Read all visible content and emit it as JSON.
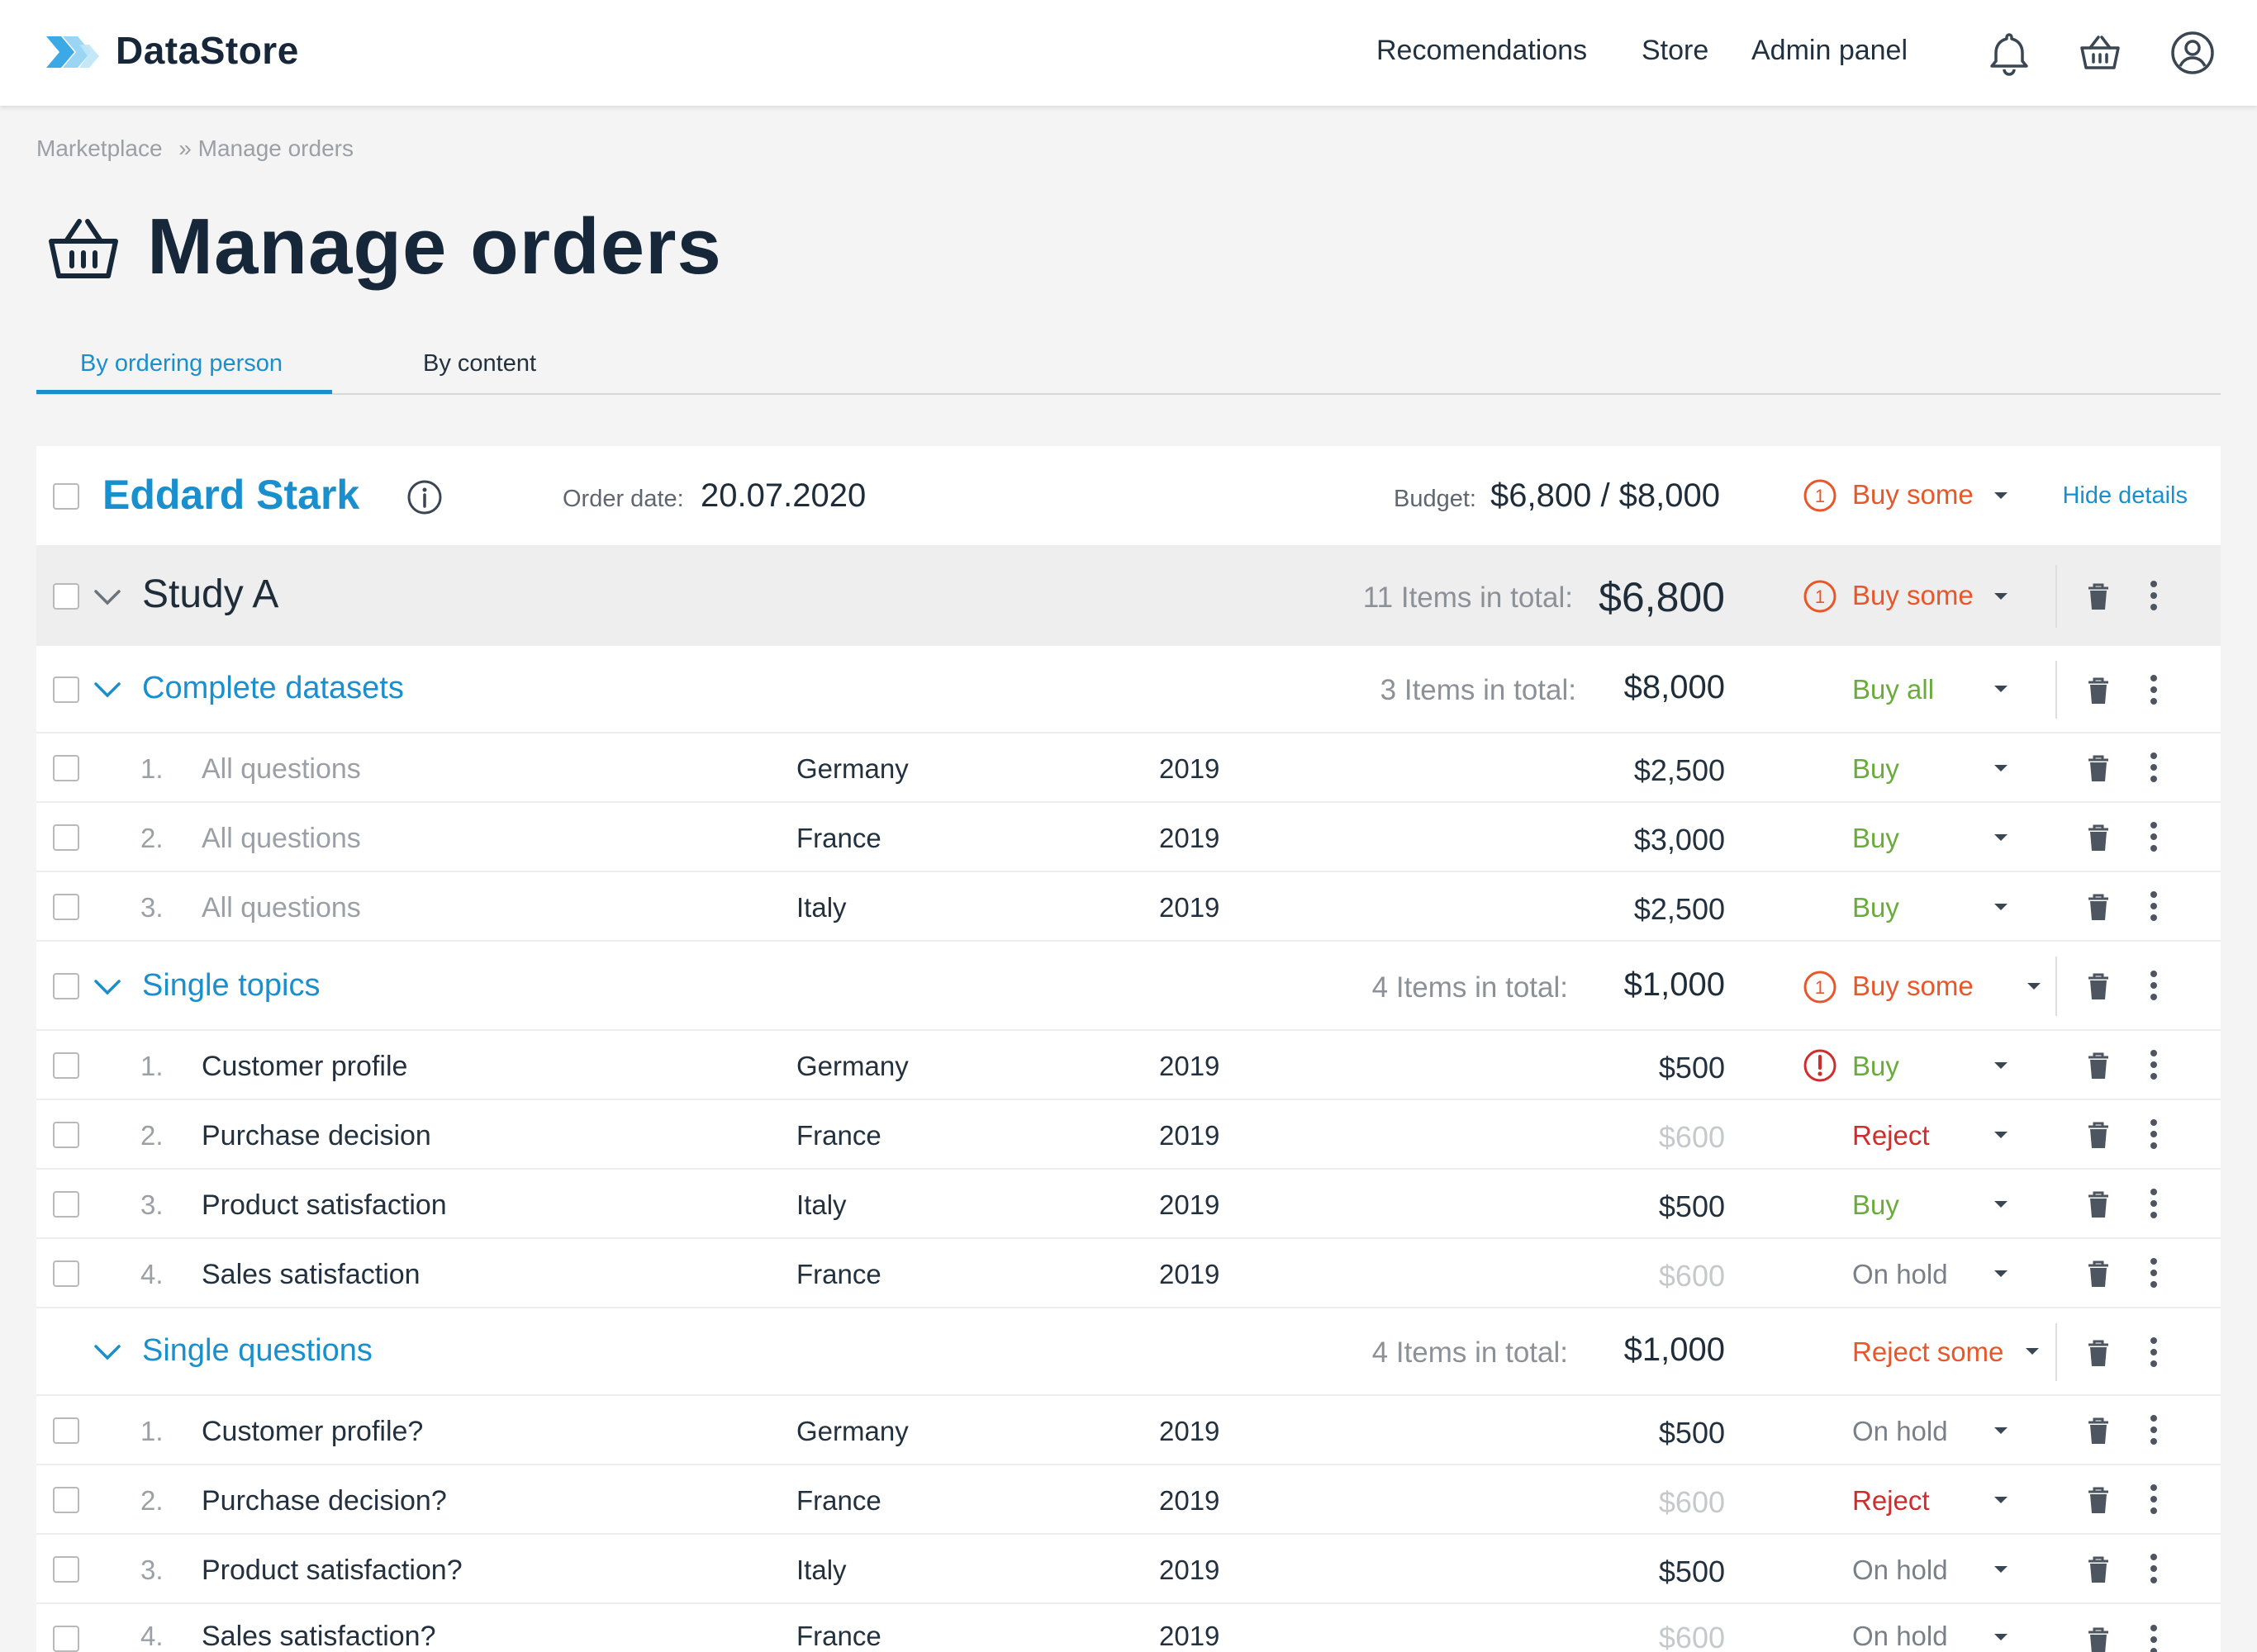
{
  "app": {
    "name": "DataStore",
    "accent_color": "#1a8fcd",
    "text_color": "#17273a"
  },
  "nav": {
    "links": [
      "Recomendations",
      "Store",
      "Admin panel"
    ],
    "icons": [
      "bell-icon",
      "basket-icon",
      "user-icon"
    ]
  },
  "breadcrumb": {
    "items": [
      "Marketplace",
      "» Manage orders"
    ]
  },
  "page": {
    "title": "Manage orders",
    "title_icon": "basket-icon"
  },
  "tabs": {
    "active": "By ordering person",
    "inactive": "By content"
  },
  "order": {
    "person": "Eddard Stark",
    "order_date_label": "Order date:",
    "order_date": "20.07.2020",
    "budget_label": "Budget:",
    "budget": "$6,800 / $8,000",
    "status": "Buy some",
    "hide_details": "Hide details"
  },
  "study": {
    "name": "Study A",
    "count_label": "11 Items in total:",
    "total": "$6,800",
    "status": "Buy some"
  },
  "groups": [
    {
      "name": "Complete datasets",
      "count_label": "3 Items in total:",
      "total": "$8,000",
      "status": "Buy all",
      "items": [
        {
          "num": "1.",
          "name": "All questions",
          "country": "Germany",
          "year": "2019",
          "price": "$2,500",
          "status": "Buy"
        },
        {
          "num": "2.",
          "name": "All questions",
          "country": "France",
          "year": "2019",
          "price": "$3,000",
          "status": "Buy"
        },
        {
          "num": "3.",
          "name": "All questions",
          "country": "Italy",
          "year": "2019",
          "price": "$2,500",
          "status": "Buy"
        }
      ]
    },
    {
      "name": "Single topics",
      "count_label": "4 Items in total:",
      "total": "$1,000",
      "status": "Buy some",
      "items": [
        {
          "num": "1.",
          "name": "Customer profile",
          "country": "Germany",
          "year": "2019",
          "price": "$500",
          "status": "Buy"
        },
        {
          "num": "2.",
          "name": "Purchase decision",
          "country": "France",
          "year": "2019",
          "price": "$600",
          "status": "Reject"
        },
        {
          "num": "3.",
          "name": "Product satisfaction",
          "country": "Italy",
          "year": "2019",
          "price": "$500",
          "status": "Buy"
        },
        {
          "num": "4.",
          "name": "Sales satisfaction",
          "country": "France",
          "year": "2019",
          "price": "$600",
          "status": "On hold"
        }
      ]
    },
    {
      "name": "Single questions",
      "count_label": "4 Items in total:",
      "total": "$1,000",
      "status": "Reject some",
      "items": [
        {
          "num": "1.",
          "name": "Customer profile?",
          "country": "Germany",
          "year": "2019",
          "price": "$500",
          "status": "On hold"
        },
        {
          "num": "2.",
          "name": "Purchase decision?",
          "country": "France",
          "year": "2019",
          "price": "$600",
          "status": "Reject"
        },
        {
          "num": "3.",
          "name": "Product satisfaction?",
          "country": "Italy",
          "year": "2019",
          "price": "$500",
          "status": "On hold"
        },
        {
          "num": "4.",
          "name": "Sales satisfaction?",
          "country": "France",
          "year": "2019",
          "price": "$600",
          "status": "On hold"
        }
      ]
    }
  ]
}
